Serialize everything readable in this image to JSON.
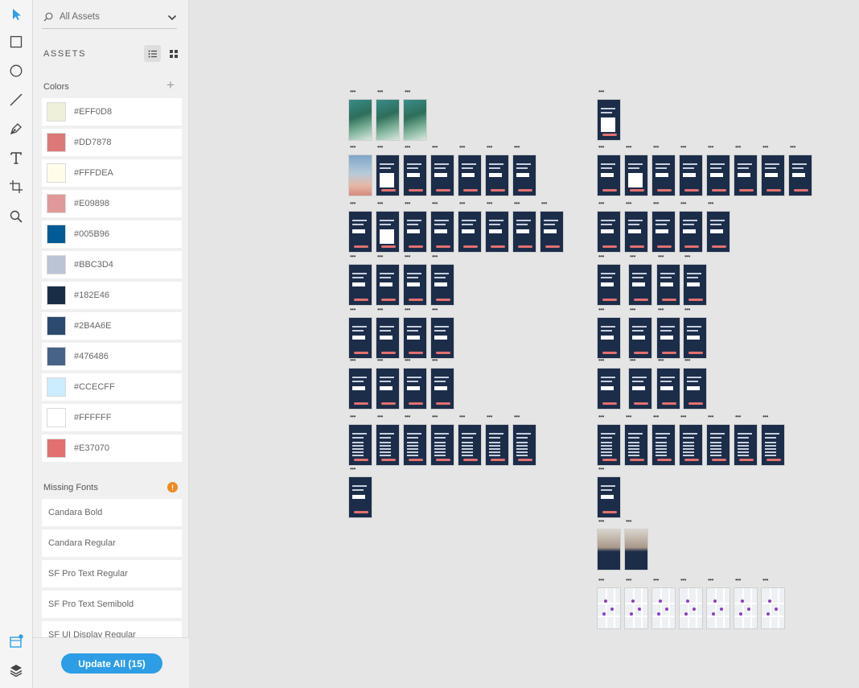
{
  "toolbar": {
    "tools": [
      "select-tool",
      "rectangle-tool",
      "ellipse-tool",
      "line-tool",
      "pen-tool",
      "text-tool",
      "artboard-tool",
      "zoom-tool"
    ],
    "bottom_tools": [
      "assets-panel-toggle",
      "layers-panel-toggle"
    ],
    "accent_color": "#2d9de6"
  },
  "search": {
    "value": "All Assets"
  },
  "assets": {
    "header": "ASSETS"
  },
  "colors": {
    "title": "Colors",
    "add_label": "+",
    "items": [
      {
        "hex": "#EFF0D8",
        "label": "#EFF0D8"
      },
      {
        "hex": "#DD7878",
        "label": "#DD7878"
      },
      {
        "hex": "#FFFDEA",
        "label": "#FFFDEA"
      },
      {
        "hex": "#E09898",
        "label": "#E09898"
      },
      {
        "hex": "#005B96",
        "label": "#005B96"
      },
      {
        "hex": "#BBC3D4",
        "label": "#BBC3D4"
      },
      {
        "hex": "#182E46",
        "label": "#182E46"
      },
      {
        "hex": "#2B4A6E",
        "label": "#2B4A6E"
      },
      {
        "hex": "#476486",
        "label": "#476486"
      },
      {
        "hex": "#CCECFF",
        "label": "#CCECFF"
      },
      {
        "hex": "#FFFFFF",
        "label": "#FFFFFF"
      },
      {
        "hex": "#E37070",
        "label": "#E37070"
      }
    ]
  },
  "fonts": {
    "title": "Missing Fonts",
    "warning_label": "!",
    "items": [
      {
        "label": "Candara Bold"
      },
      {
        "label": "Candara Regular"
      },
      {
        "label": "SF Pro Text Regular"
      },
      {
        "label": "SF Pro Text Semibold"
      },
      {
        "label": "SF UI Display Regular"
      }
    ]
  },
  "update_button": {
    "label": "Update All (15)"
  },
  "canvas": {
    "dots_label": "•••"
  }
}
